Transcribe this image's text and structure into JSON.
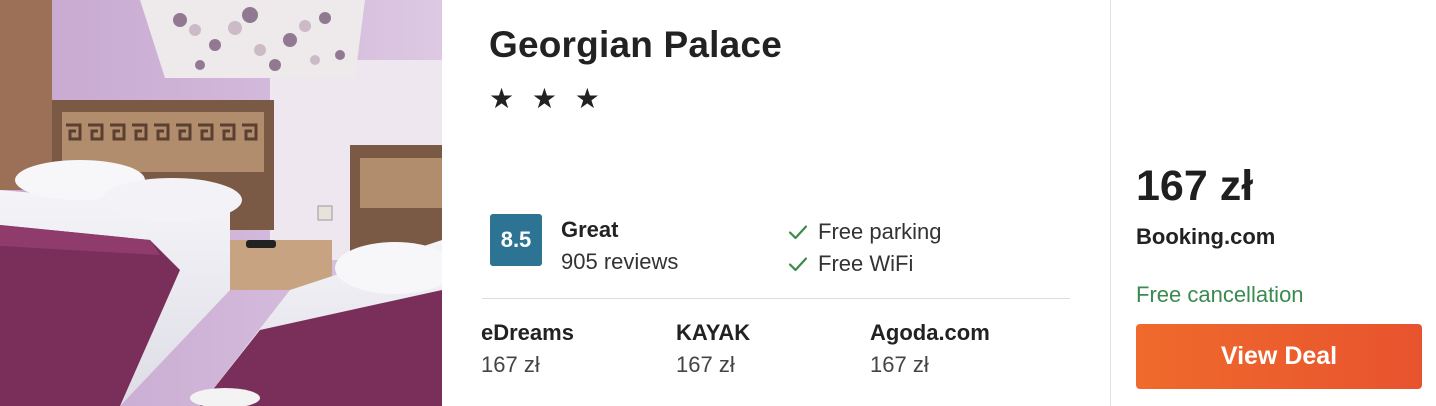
{
  "hotel": {
    "name": "Georgian Palace",
    "star_rating": 3,
    "stars_text": "★ ★ ★",
    "rating": {
      "score": "8.5",
      "label": "Great",
      "reviews": "905 reviews"
    },
    "amenities": [
      "Free parking",
      "Free WiFi"
    ]
  },
  "providers": [
    {
      "name": "eDreams",
      "price": "167 zł"
    },
    {
      "name": "KAYAK",
      "price": "167 zł"
    },
    {
      "name": "Agoda.com",
      "price": "167 zł"
    }
  ],
  "deal": {
    "price": "167 zł",
    "provider": "Booking.com",
    "cancellation": "Free cancellation",
    "button_label": "View Deal"
  },
  "colors": {
    "rating_badge": "#2d7393",
    "check": "#3b8a4e",
    "cancellation_text": "#3b8a4e",
    "button": "#e8532e"
  },
  "icons": {
    "check": "check-icon",
    "star": "star-icon"
  }
}
